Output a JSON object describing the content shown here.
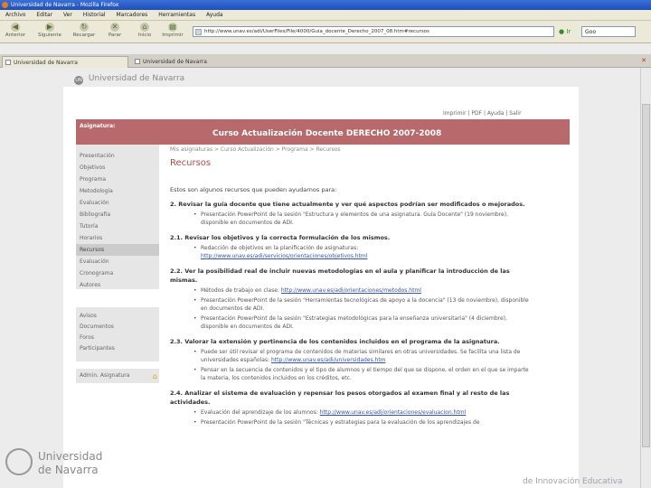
{
  "window": {
    "title": "Universidad de Navarra - Mozilla Firefox"
  },
  "menu": [
    "Archivo",
    "Editar",
    "Ver",
    "Historial",
    "Marcadores",
    "Herramientas",
    "Ayuda"
  ],
  "toolbar": {
    "back": "Anterior",
    "forward": "Siguiente",
    "reload": "Recargar",
    "stop": "Parar",
    "home": "Inicio",
    "print": "Imprimir",
    "url": "http://www.unav.es/adi/UserFiles/File/4000/Guia_docente_Derecho_2007_08.htm#recursos",
    "go": "Ir",
    "search": "Goo"
  },
  "tabs": [
    {
      "label": "Universidad de Navarra",
      "active": true
    },
    {
      "label": "Universidad de Navarra",
      "active": false
    }
  ],
  "site": {
    "logo": "Universidad de Navarra",
    "seal": "UN",
    "toplinks": "Imprimir | PDF | Ayuda | Salir"
  },
  "banner": {
    "subject_label": "Asignatura:",
    "course_title": "Curso Actualización Docente DERECHO   2007-2008"
  },
  "leftnav": {
    "items": [
      "Presentación",
      "Objetivos",
      "Programa",
      "Metodología",
      "Evaluación",
      "Bibliografía",
      "Tutoría",
      "Horarios",
      "Recursos",
      "Evaluación",
      "Cronograma",
      "Autores"
    ],
    "active_index": 8
  },
  "leftnav2": {
    "items": [
      "Avisos",
      "Documentos",
      "Foros",
      "Participantes"
    ]
  },
  "leftnav3": {
    "label": "Admin. Asignatura"
  },
  "content": {
    "breadcrumb": "Mis asignaturas > Curso Actualización > Programa > Recursos",
    "heading": "Recursos",
    "intro": "Estos son algunos recursos que pueden ayudarnos para:",
    "s1": "2. Revisar la guía docente que tiene actualmente y ver qué aspectos podrían ser modificados o mejorados.",
    "s1b1": "Presentación PowerPoint de la sesión \"Estructura y elementos de una asignatura. Guía Docente\" (19 noviembre), disponible en documentos de ADI.",
    "s2": "2.1. Revisar los objetivos y la correcta formulación de los mismos.",
    "s2b1_text": "Redacción de objetivos en la planificación de asignaturas:",
    "s2b1_link": "http://www.unav.es/adi/servicios/orientaciones/objetivos.html",
    "s3": "2.2. Ver la posibilidad real de incluir nuevas metodologías en el aula y planificar la introducción de las mismas.",
    "s3b1_text": "Métodos de trabajo en clase:",
    "s3b1_link": "http://www.unav.es/adi/orientaciones/metodos.html",
    "s3b2": "Presentación PowerPoint de la sesión \"Herramientas tecnológicas de apoyo a la docencia\" (13 de noviembre), disponible en documentos de ADI.",
    "s3b3": "Presentación PowerPoint de la sesión \"Estrategias metodológicas para la enseñanza universitaria\" (4 diciembre), disponible en documentos de ADI.",
    "s4": "2.3. Valorar la extensión y pertinencia de los contenidos incluidos en el programa de la asignatura.",
    "s4b1_text": "Puede ser útil revisar el programa de contenidos de materias similares en otras universidades. Se facilita una lista de universidades españolas:",
    "s4b1_link": "http://www.unav.es/adi/universidades.htm",
    "s4b2": "Pensar en la secuencia de contenidos y el tipo de alumnos y el tiempo del que se dispone, el orden en el que se imparte la materia, los contenidos incluidos en los créditos, etc.",
    "s5": "2.4. Analizar el sistema de evaluación y repensar los pesos otorgados al examen final y al resto de las actividades.",
    "s5b1_text": "Evaluación del aprendizaje de los alumnos:",
    "s5b1_link": "http://www.unav.es/adi/orientaciones/evaluacion.html",
    "s5b2": "Presentación PowerPoint de la sesión \"Técnicas y estrategias para la evaluación de los aprendizajes de"
  },
  "footer": {
    "logo_line1": "Universidad",
    "logo_line2": "de Navarra",
    "tagline": "de Innovación Educativa"
  }
}
